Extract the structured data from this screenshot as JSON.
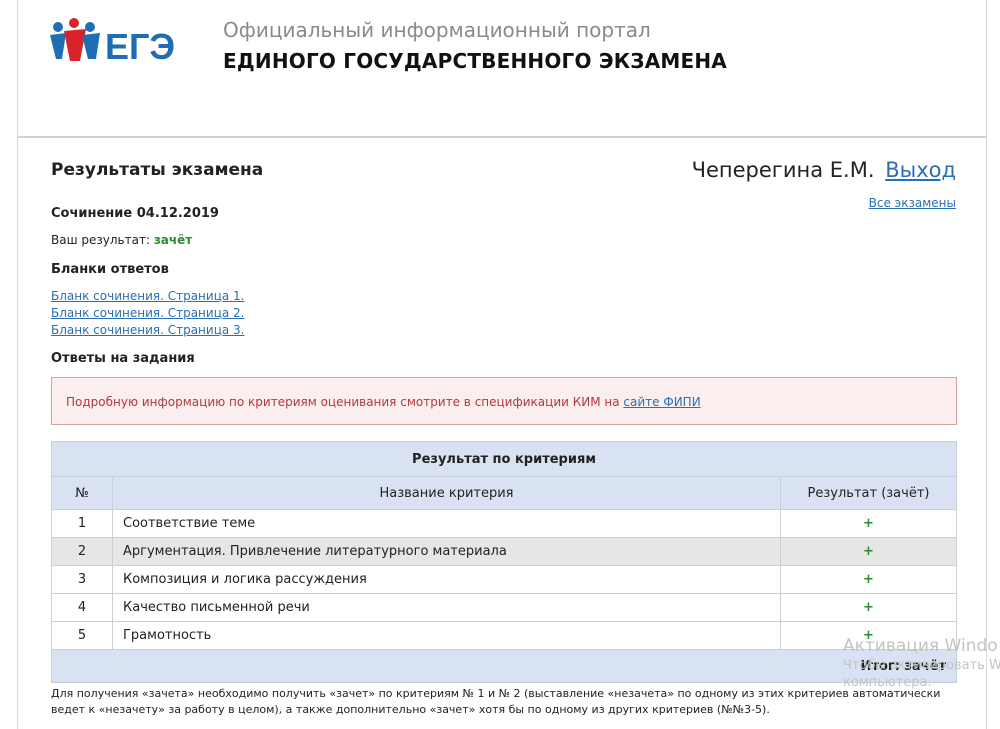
{
  "header": {
    "logo_text": "ЕГЭ",
    "portal_subtitle": "Официальный информационный портал",
    "portal_title": "ЕДИНОГО ГОСУДАРСТВЕННОГО ЭКЗАМЕНА"
  },
  "page": {
    "title": "Результаты экзамена",
    "user_name": "Чеперегина Е.М.",
    "logout": "Выход",
    "all_exams": "Все экзамены"
  },
  "exam": {
    "title": "Сочинение 04.12.2019",
    "result_label": "Ваш результат:",
    "result_value": "зачёт"
  },
  "blanks": {
    "title": "Бланки ответов",
    "links": [
      "Бланк сочинения. Страница 1.",
      "Бланк сочинения. Страница 2.",
      "Бланк сочинения. Страница 3."
    ]
  },
  "answers": {
    "title": "Ответы на задания",
    "alert_text": "Подробную информацию по критериям оценивания смотрите в спецификации КИМ на",
    "alert_link": "сайте ФИПИ"
  },
  "criteria": {
    "caption": "Результат по критериям",
    "col_num": "№",
    "col_name": "Название критерия",
    "col_result": "Результат (зачёт)",
    "rows": [
      {
        "num": "1",
        "name": "Соответствие теме",
        "result": "+"
      },
      {
        "num": "2",
        "name": "Аргументация. Привлечение литературного материала",
        "result": "+"
      },
      {
        "num": "3",
        "name": "Композиция и логика рассуждения",
        "result": "+"
      },
      {
        "num": "4",
        "name": "Качество письменной речи",
        "result": "+"
      },
      {
        "num": "5",
        "name": "Грамотность",
        "result": "+"
      }
    ],
    "total": "Итог: зачёт"
  },
  "note": "Для получения «зачета» необходимо получить «зачет» по критериям № 1 и № 2 (выставление «незачета» по одному из этих критериев автоматически ведет к «незачету» за работу в целом), а также дополнительно «зачет» хотя бы по одному из других критериев (№№3-5).",
  "watermark": {
    "line1": "Активация Windo",
    "line2": "Чтобы активировать W",
    "line3": "компьютера."
  },
  "colors": {
    "brand_blue": "#1f6db3",
    "brand_red": "#d6242a",
    "link": "#2a6fb5",
    "pass_green": "#2e8b2e",
    "table_header": "#d9e2f3"
  }
}
